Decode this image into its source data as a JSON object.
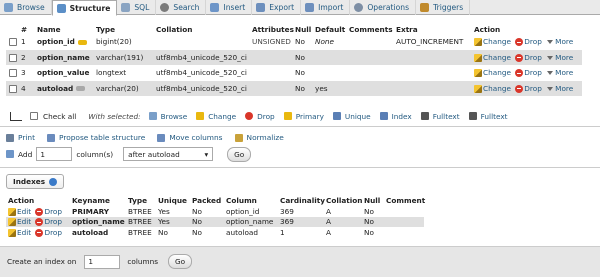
{
  "tabs": [
    {
      "label": "Browse",
      "icon": "browse-icon",
      "color": "#7a9fc9"
    },
    {
      "label": "Structure",
      "icon": "structure-icon",
      "color": "#5b8fc7",
      "active": true
    },
    {
      "label": "SQL",
      "icon": "sql-icon",
      "color": "#8aa4c2"
    },
    {
      "label": "Search",
      "icon": "search-icon",
      "color": "#7b7b7b"
    },
    {
      "label": "Insert",
      "icon": "insert-icon",
      "color": "#6d95c8"
    },
    {
      "label": "Export",
      "icon": "export-icon",
      "color": "#6d8fbd"
    },
    {
      "label": "Import",
      "icon": "import-icon",
      "color": "#6d8fbd"
    },
    {
      "label": "Operations",
      "icon": "operations-icon",
      "color": "#7e8fa5"
    },
    {
      "label": "Triggers",
      "icon": "triggers-icon",
      "color": "#c08a2c"
    }
  ],
  "structure": {
    "headers": {
      "num": "#",
      "name": "Name",
      "type": "Type",
      "collation": "Collation",
      "attributes": "Attributes",
      "null": "Null",
      "default": "Default",
      "comments": "Comments",
      "extra": "Extra",
      "action": "Action"
    },
    "rows": [
      {
        "num": "1",
        "name": "option_id",
        "key": "primary-key-icon",
        "type": "bigint(20)",
        "collation": "",
        "attributes": "UNSIGNED",
        "null": "No",
        "default": "None",
        "extra": "AUTO_INCREMENT"
      },
      {
        "num": "2",
        "name": "option_name",
        "key": "unique-key-icon",
        "type": "varchar(191)",
        "collation": "utf8mb4_unicode_520_ci",
        "attributes": "",
        "null": "No",
        "default": "",
        "extra": ""
      },
      {
        "num": "3",
        "name": "option_value",
        "key": "",
        "type": "longtext",
        "collation": "utf8mb4_unicode_520_ci",
        "attributes": "",
        "null": "No",
        "default": "",
        "extra": ""
      },
      {
        "num": "4",
        "name": "autoload",
        "key": "index-key-icon",
        "type": "varchar(20)",
        "collation": "utf8mb4_unicode_520_ci",
        "attributes": "",
        "null": "No",
        "default": "yes",
        "extra": ""
      }
    ],
    "actions": {
      "change": "Change",
      "drop": "Drop",
      "more": "More"
    }
  },
  "bulk": {
    "check_all": "Check all",
    "with_selected": "With selected:",
    "items": [
      {
        "label": "Browse",
        "icon": "browse-icon",
        "color": "#7a9fc9"
      },
      {
        "label": "Change",
        "icon": "pencil-icon",
        "color": "#e9b80f"
      },
      {
        "label": "Drop",
        "icon": "drop-icon",
        "color": "#d9362a"
      },
      {
        "label": "Primary",
        "icon": "primary-key-icon",
        "color": "#e9b80f"
      },
      {
        "label": "Unique",
        "icon": "unique-icon",
        "color": "#5a7fb5"
      },
      {
        "label": "Index",
        "icon": "index-icon",
        "color": "#5a7fb5"
      },
      {
        "label": "Fulltext",
        "icon": "fulltext-icon",
        "color": "#555555"
      },
      {
        "label": "Fulltext",
        "icon": "fulltext-icon",
        "color": "#555555"
      }
    ]
  },
  "tools": [
    {
      "label": "Print",
      "icon": "print-icon",
      "color": "#6a7f9a"
    },
    {
      "label": "Propose table structure",
      "icon": "propose-icon",
      "color": "#6a8bbd"
    },
    {
      "label": "Move columns",
      "icon": "move-columns-icon",
      "color": "#6a8bbd"
    },
    {
      "label": "Normalize",
      "icon": "normalize-icon",
      "color": "#c9a23a"
    }
  ],
  "add_columns": {
    "add_label": "Add",
    "count": "1",
    "columns_label": "column(s)",
    "position": "after autoload",
    "go": "Go"
  },
  "indexes": {
    "legend": "Indexes",
    "headers": {
      "action": "Action",
      "keyname": "Keyname",
      "type": "Type",
      "unique": "Unique",
      "packed": "Packed",
      "column": "Column",
      "cardinality": "Cardinality",
      "collation": "Collation",
      "null": "Null",
      "comment": "Comment"
    },
    "edit": "Edit",
    "drop": "Drop",
    "rows": [
      {
        "keyname": "PRIMARY",
        "type": "BTREE",
        "unique": "Yes",
        "packed": "No",
        "column": "option_id",
        "cardinality": "369",
        "collation": "A",
        "null": "No",
        "comment": ""
      },
      {
        "keyname": "option_name",
        "type": "BTREE",
        "unique": "Yes",
        "packed": "No",
        "column": "option_name",
        "cardinality": "369",
        "collation": "A",
        "null": "No",
        "comment": ""
      },
      {
        "keyname": "autoload",
        "type": "BTREE",
        "unique": "No",
        "packed": "No",
        "column": "autoload",
        "cardinality": "1",
        "collation": "A",
        "null": "No",
        "comment": ""
      }
    ]
  },
  "create_index": {
    "prefix": "Create an index on",
    "count": "1",
    "suffix": "columns",
    "go": "Go"
  }
}
